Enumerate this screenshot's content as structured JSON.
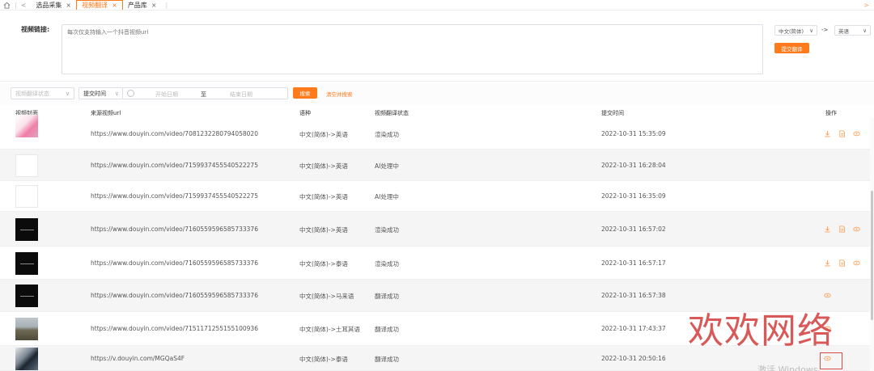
{
  "tabs": {
    "back_glyph": "<",
    "items": [
      {
        "label": "选品采集",
        "close": "×",
        "active": false
      },
      {
        "label": "视频翻译",
        "close": "×",
        "active": true
      },
      {
        "label": "产品库",
        "close": "×",
        "active": false
      }
    ],
    "forward_glyph": ">"
  },
  "form": {
    "label": "视频链接:",
    "placeholder": "每次仅支持输入一个抖音视频url",
    "source_lang": "中文(简体)",
    "arrow": "->",
    "target_lang": "英语",
    "submit_label": "提交翻译"
  },
  "filters": {
    "status_placeholder": "视频翻译状态",
    "time_field": "提交时间",
    "start_placeholder": "开始日期",
    "to_label": "至",
    "end_placeholder": "结束日期",
    "search_label": "搜索",
    "clear_label": "清空并搜索"
  },
  "table": {
    "headers": [
      "视频封面",
      "来源视频url",
      "语种",
      "视频翻译状态",
      "提交时间",
      "操作"
    ],
    "rows": [
      {
        "url": "https://www.douyin.com/video/7081232280794058020",
        "lang": "中文(简体)->英语",
        "status": "渲染成功",
        "time": "2022-10-31 15:35:09",
        "thumb": "pink"
      },
      {
        "url": "https://www.douyin.com/video/7159937455540522275",
        "lang": "中文(简体)->英语",
        "status": "AI处理中",
        "time": "2022-10-31 16:28:04",
        "thumb": "blank"
      },
      {
        "url": "https://www.douyin.com/video/7159937455540522275",
        "lang": "中文(简体)->英语",
        "status": "AI处理中",
        "time": "2022-10-31 16:35:09",
        "thumb": "blank"
      },
      {
        "url": "https://www.douyin.com/video/7160559596585733376",
        "lang": "中文(简体)->英语",
        "status": "渲染成功",
        "time": "2022-10-31 16:57:02",
        "thumb": "dark"
      },
      {
        "url": "https://www.douyin.com/video/7160559596585733376",
        "lang": "中文(简体)->泰语",
        "status": "渲染成功",
        "time": "2022-10-31 16:57:17",
        "thumb": "dark"
      },
      {
        "url": "https://www.douyin.com/video/7160559596585733376",
        "lang": "中文(简体)->马来语",
        "status": "翻译成功",
        "time": "2022-10-31 16:57:38",
        "thumb": "dark"
      },
      {
        "url": "https://www.douyin.com/video/7151171255155100936",
        "lang": "中文(简体)->土耳其语",
        "status": "翻译成功",
        "time": "2022-10-31 17:43:37",
        "thumb": "landscape"
      },
      {
        "url": "https://v.douyin.com/MGQaS4F",
        "lang": "中文(简体)->泰语",
        "status": "翻译成功",
        "time": "2022-10-31 20:50:16",
        "thumb": "car"
      }
    ]
  },
  "overlay": {
    "watermark": "欢欢网络",
    "activate_text": "激活 Windows"
  },
  "colors": {
    "accent": "#ff7a1a",
    "watermark": "#d64b4b"
  }
}
